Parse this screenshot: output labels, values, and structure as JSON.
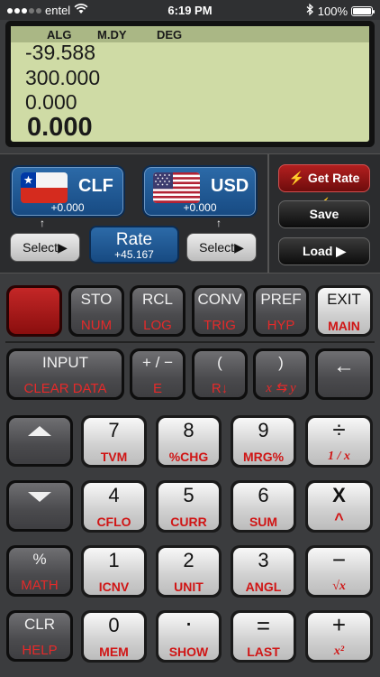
{
  "status_bar": {
    "carrier": "entel",
    "time": "6:19 PM",
    "battery": "100%",
    "battery_level": 1.0
  },
  "display": {
    "modes": [
      "ALG",
      "M.DY",
      "DEG"
    ],
    "registers": [
      "-39.588",
      "300.000",
      "0.000"
    ],
    "x_register": "0.000"
  },
  "converter": {
    "from": {
      "code": "CLF",
      "amount": "+0.000",
      "flag": "chile-flag"
    },
    "to": {
      "code": "USD",
      "amount": "+0.000",
      "flag": "usa-flag"
    },
    "select_label": "Select▶",
    "rate_label": "Rate",
    "rate_value": "+45.167",
    "up_arrow": "↑",
    "get_rate_label": "Get Rate",
    "bolt": "⚡",
    "save_label": "Save",
    "load_label": "Load ▶"
  },
  "keys": {
    "row1": [
      {
        "p": "",
        "s": ""
      },
      {
        "p": "STO",
        "s": "NUM"
      },
      {
        "p": "RCL",
        "s": "LOG"
      },
      {
        "p": "CONV",
        "s": "TRIG"
      },
      {
        "p": "PREF",
        "s": "HYP"
      },
      {
        "p": "EXIT",
        "s": "MAIN"
      }
    ],
    "row2": [
      {
        "p": "INPUT",
        "s": "CLEAR DATA"
      },
      {
        "p": "+ / −",
        "s": "E"
      },
      {
        "p": "(",
        "s": "R↓"
      },
      {
        "p": ")",
        "s": "x ⇆ y"
      },
      {
        "p": "←",
        "s": ""
      }
    ],
    "row3": [
      {
        "p": "",
        "s": ""
      },
      {
        "p": "7",
        "s": "TVM"
      },
      {
        "p": "8",
        "s": "%CHG"
      },
      {
        "p": "9",
        "s": "MRG%"
      },
      {
        "p": "÷",
        "s": "1 / x"
      }
    ],
    "row4": [
      {
        "p": "",
        "s": ""
      },
      {
        "p": "4",
        "s": "CFLO"
      },
      {
        "p": "5",
        "s": "CURR"
      },
      {
        "p": "6",
        "s": "SUM"
      },
      {
        "p": "X",
        "s": "^"
      }
    ],
    "row5": [
      {
        "p": "%",
        "s": "MATH"
      },
      {
        "p": "1",
        "s": "ICNV"
      },
      {
        "p": "2",
        "s": "UNIT"
      },
      {
        "p": "3",
        "s": "ANGL"
      },
      {
        "p": "−",
        "s": "√x"
      }
    ],
    "row6": [
      {
        "p": "CLR",
        "s": "HELP"
      },
      {
        "p": "0",
        "s": "MEM"
      },
      {
        "p": "·",
        "s": "SHOW"
      },
      {
        "p": "=",
        "s": "LAST"
      },
      {
        "p": "+",
        "s": "x²"
      }
    ]
  }
}
